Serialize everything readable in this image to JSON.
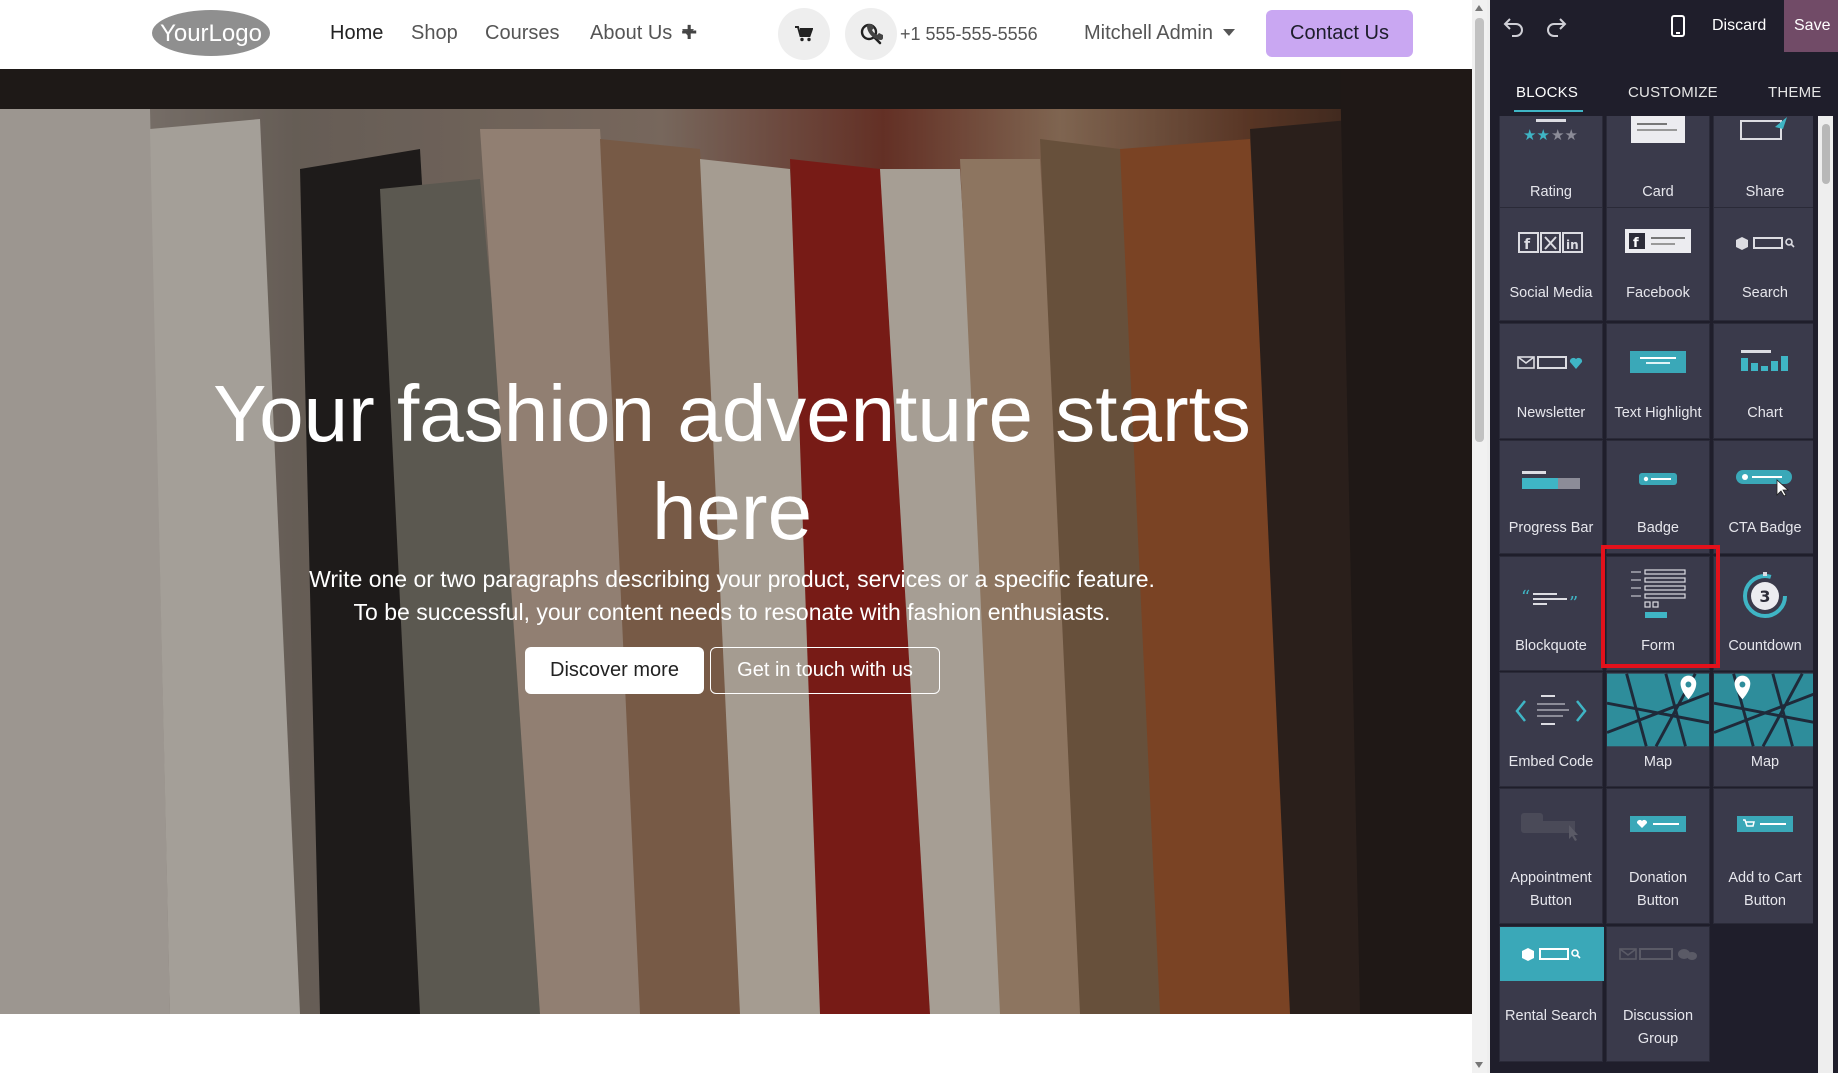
{
  "site": {
    "logo_text": "YourLogo",
    "nav": {
      "home": "Home",
      "shop": "Shop",
      "courses": "Courses",
      "about": "About Us",
      "phone": "+1 555-555-5556",
      "user": "Mitchell Admin",
      "contact": "Contact Us"
    },
    "hero": {
      "title": "Your fashion adventure starts here",
      "description_line1": "Write one or two paragraphs describing your product, services or a specific feature.",
      "description_line2": "To be successful, your content needs to resonate with fashion enthusiasts.",
      "primary_button": "Discover more",
      "secondary_button": "Get in touch with us"
    }
  },
  "editor": {
    "discard": "Discard",
    "save": "Save",
    "tabs": [
      "BLOCKS",
      "CUSTOMIZE",
      "THEME"
    ],
    "active_tab": "BLOCKS",
    "blocks": [
      {
        "label": "Rating",
        "icon": "rating-icon"
      },
      {
        "label": "Card",
        "icon": "card-icon"
      },
      {
        "label": "Share",
        "icon": "share-icon"
      },
      {
        "label": "Social Media",
        "icon": "social-media-icon"
      },
      {
        "label": "Facebook",
        "icon": "facebook-icon"
      },
      {
        "label": "Search",
        "icon": "search-block-icon"
      },
      {
        "label": "Newsletter",
        "icon": "newsletter-icon"
      },
      {
        "label": "Text Highlight",
        "icon": "text-highlight-icon"
      },
      {
        "label": "Chart",
        "icon": "chart-icon"
      },
      {
        "label": "Progress Bar",
        "icon": "progress-bar-icon"
      },
      {
        "label": "Badge",
        "icon": "badge-icon"
      },
      {
        "label": "CTA Badge",
        "icon": "cta-badge-icon"
      },
      {
        "label": "Blockquote",
        "icon": "blockquote-icon"
      },
      {
        "label": "Form",
        "icon": "form-icon",
        "highlighted": true
      },
      {
        "label": "Countdown",
        "icon": "countdown-icon",
        "countdown_number": "3"
      },
      {
        "label": "Embed Code",
        "icon": "embed-code-icon"
      },
      {
        "label": "Map",
        "icon": "map-icon"
      },
      {
        "label": "Map",
        "icon": "map-icon"
      },
      {
        "label": "Appointment Button",
        "icon": "appointment-button-icon"
      },
      {
        "label": "Donation Button",
        "icon": "donation-button-icon"
      },
      {
        "label": "Add to Cart Button",
        "icon": "add-to-cart-button-icon"
      },
      {
        "label": "Rental Search",
        "icon": "rental-search-icon"
      },
      {
        "label": "Discussion Group",
        "icon": "discussion-group-icon"
      }
    ],
    "colors": {
      "panel_bg": "#1f1e2b",
      "block_bg": "#3a3a4b",
      "accent": "#3fb5c5",
      "save_bg": "#714b67",
      "highlight": "#e3111b",
      "contact_button": "#c9a7f2"
    }
  }
}
